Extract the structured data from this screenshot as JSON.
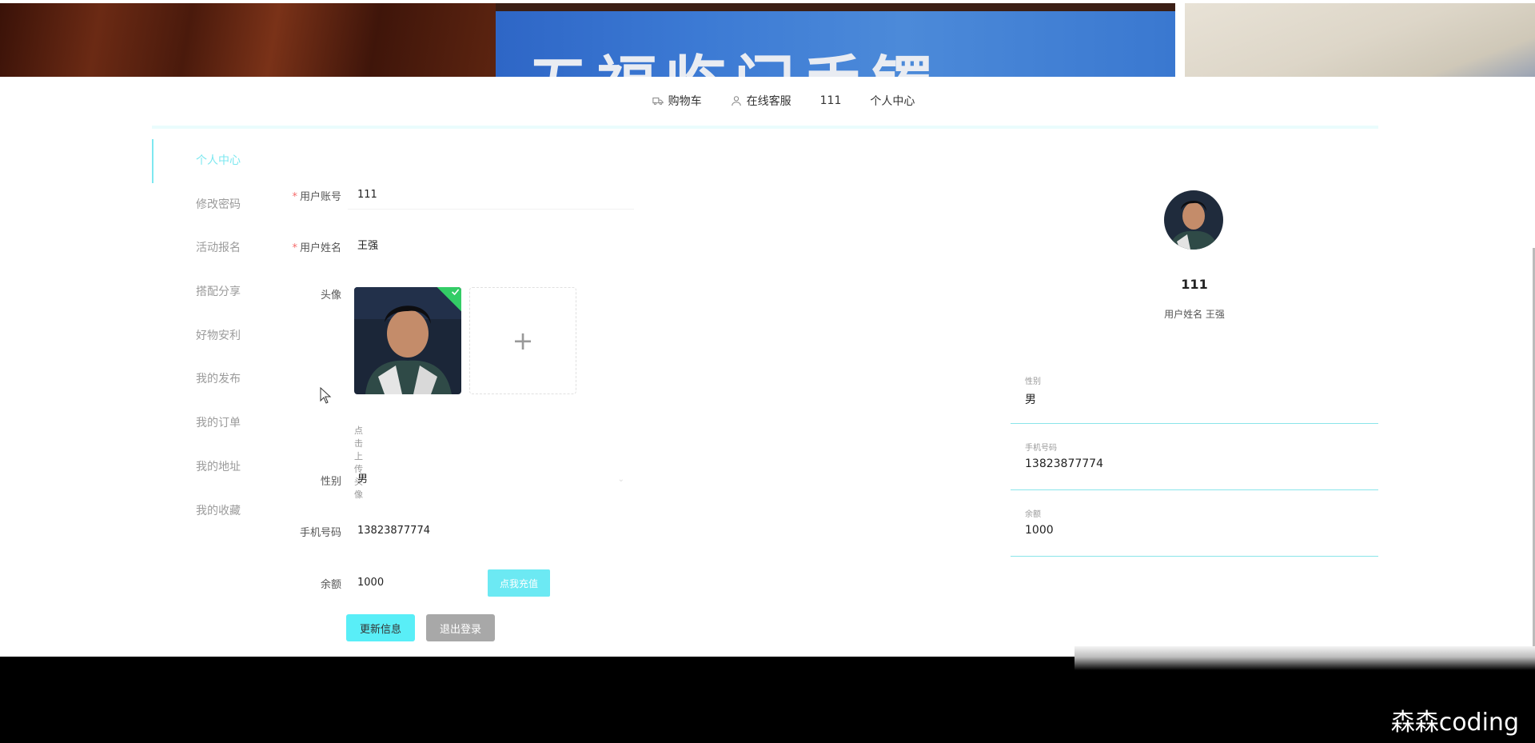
{
  "banner": {
    "center_text": "五福临门手镯"
  },
  "topnav": {
    "items": [
      {
        "label": "购物车",
        "icon": "truck-icon"
      },
      {
        "label": "在线客服",
        "icon": "user-icon"
      },
      {
        "label": "111"
      },
      {
        "label": "个人中心"
      }
    ]
  },
  "sidebar": {
    "items": [
      {
        "label": "个人中心",
        "active": true
      },
      {
        "label": "修改密码"
      },
      {
        "label": "活动报名"
      },
      {
        "label": "搭配分享"
      },
      {
        "label": "好物安利"
      },
      {
        "label": "我的发布"
      },
      {
        "label": "我的订单"
      },
      {
        "label": "我的地址"
      },
      {
        "label": "我的收藏"
      }
    ]
  },
  "form": {
    "account_label": "用户账号",
    "account_value": "111",
    "name_label": "用户姓名",
    "name_value": "王强",
    "avatar_label": "头像",
    "avatar_hint": "点击上传头像",
    "upload_plus": "+",
    "gender_label": "性别",
    "gender_value": "男",
    "phone_label": "手机号码",
    "phone_value": "13823877774",
    "balance_label": "余额",
    "balance_value": "1000",
    "recharge_label": "点我充值",
    "update_label": "更新信息",
    "logout_label": "退出登录"
  },
  "profile": {
    "username": "111",
    "subtitle": "用户姓名 王强",
    "fields": [
      {
        "label": "性别",
        "value": "男"
      },
      {
        "label": "手机号码",
        "value": "13823877774"
      },
      {
        "label": "余额",
        "value": "1000"
      }
    ]
  },
  "watermark": "森森coding",
  "colors": {
    "accent": "#59eef7",
    "active_text": "#7ee8f0",
    "required": "#f56c6c",
    "logout": "#a8a8a8"
  }
}
